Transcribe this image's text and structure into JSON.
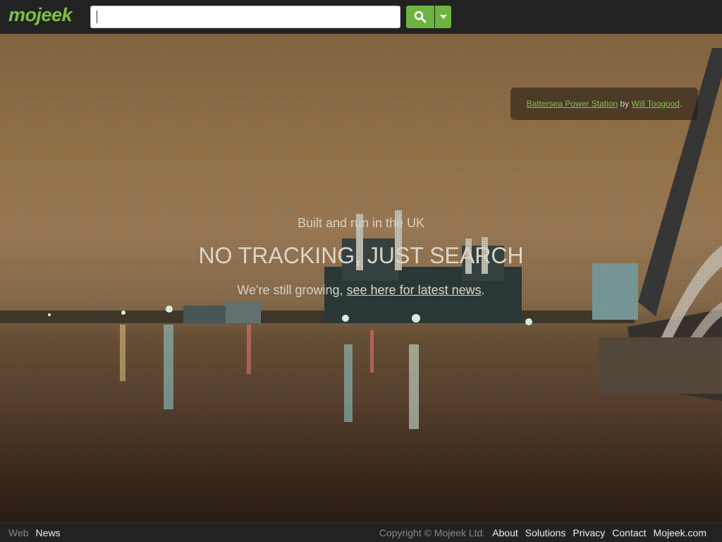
{
  "header": {
    "logo": "mojeek",
    "search_value": "",
    "icons": {
      "search": "search-icon",
      "dropdown": "caret-down-icon"
    },
    "accent": "#6db33f"
  },
  "credit": {
    "photo": "Battersea Power Station",
    "by": "by",
    "author": "Will Toogood",
    "end": "."
  },
  "hero": {
    "line1": "Built and run in the UK",
    "line2": "NO TRACKING, JUST SEARCH",
    "line3_prefix": "We're still growing, ",
    "line3_link": "see here for latest news",
    "line3_suffix": "."
  },
  "footer": {
    "left": [
      "Web",
      "News"
    ],
    "copyright": "Copyright © Mojeek Ltd.",
    "links": [
      "About",
      "Solutions",
      "Privacy",
      "Contact",
      "Mojeek.com"
    ]
  }
}
